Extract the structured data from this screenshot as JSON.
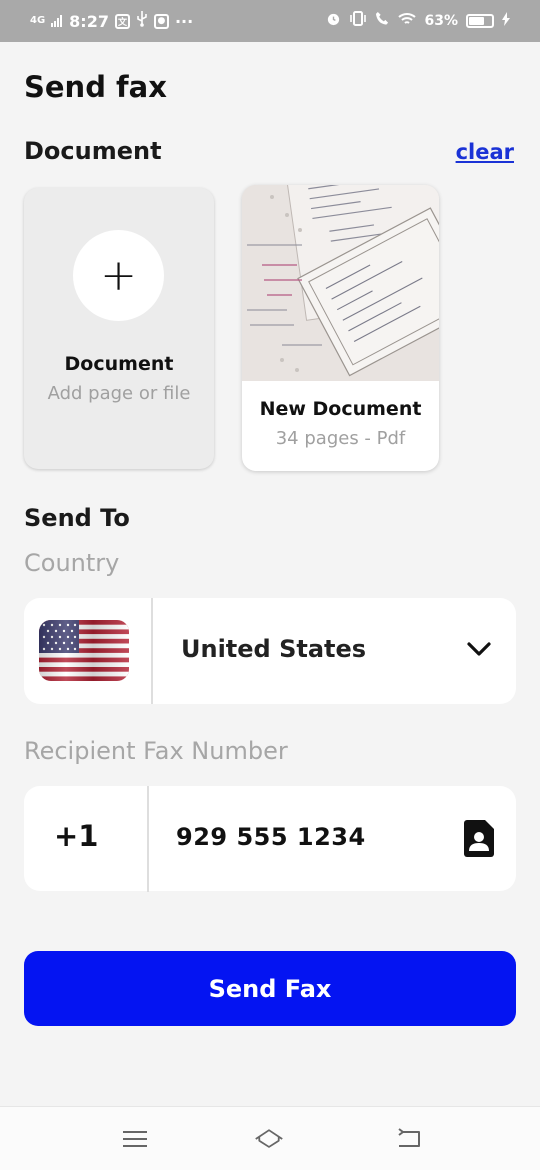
{
  "status_bar": {
    "network": "4G",
    "time": "8:27",
    "dots": "···",
    "battery_percent": "63%"
  },
  "page": {
    "title": "Send fax"
  },
  "document_section": {
    "label": "Document",
    "clear_label": "clear",
    "add_card": {
      "icon": "plus-icon",
      "plus": "+",
      "title": "Document",
      "subtitle": "Add page or file"
    },
    "doc_card": {
      "title": "New Document",
      "subtitle": "34 pages - Pdf"
    }
  },
  "send_to": {
    "label": "Send To",
    "country_label": "Country",
    "country": {
      "flag_icon": "us-flag-icon",
      "name": "United States"
    },
    "fax_label": "Recipient Fax Number",
    "country_code": "+1",
    "fax_number": "929 555 1234"
  },
  "actions": {
    "send_label": "Send Fax",
    "accent_color": "#0414f2",
    "link_color": "#1a32d6"
  },
  "nav": {
    "icons": [
      "menu-icon",
      "home-icon",
      "back-icon"
    ]
  }
}
